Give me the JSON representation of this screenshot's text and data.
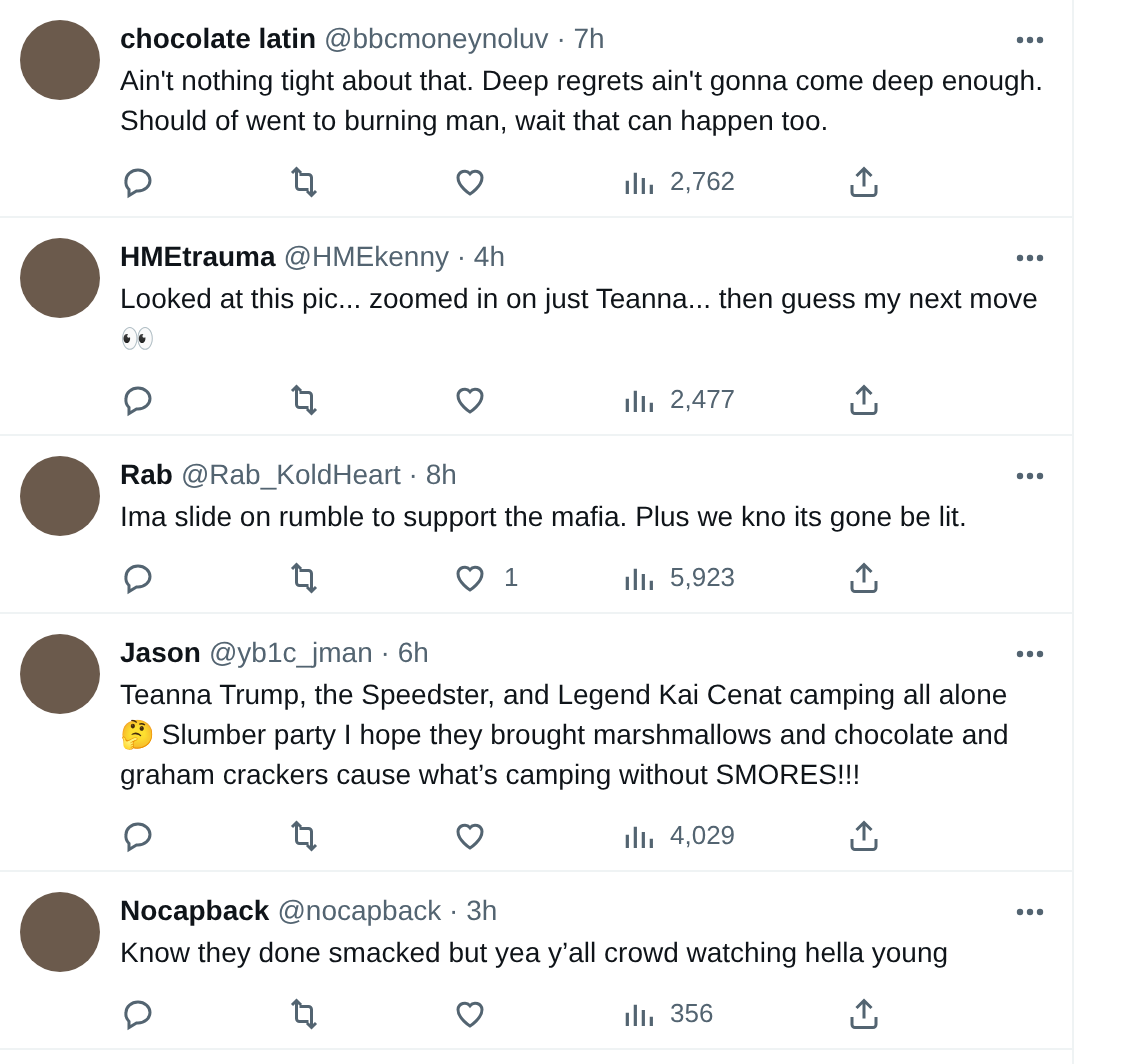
{
  "tweets": [
    {
      "name": "chocolate latin",
      "handle_time": "@bbcmoneynoluv · 7h",
      "text": "Ain't nothing tight about that. Deep regrets ain't gonna come deep enough. Should of went to burning man, wait that can happen too.",
      "views": "2,762"
    },
    {
      "name": "HMEtrauma",
      "handle_time": "@HMEkenny · 4h",
      "text": "Looked at this pic... zoomed in on just Teanna... then guess my next move 👀",
      "views": "2,477"
    },
    {
      "name": "Rab",
      "handle_time": "@Rab_KoldHeart · 8h",
      "text": "Ima slide on rumble to support the mafia. Plus we kno its gone be lit.",
      "likes": "1",
      "views": "5,923"
    },
    {
      "name": "Jason",
      "handle_time": "@yb1c_jman · 6h",
      "text": "Teanna Trump, the Speedster, and Legend Kai Cenat camping all alone 🤔 Slumber party I hope they brought marshmallows and chocolate and graham crackers cause what’s camping without SMORES!!!",
      "views": "4,029"
    },
    {
      "name": "Nocapback",
      "handle_time": "@nocapback · 3h",
      "text": "Know they done smacked but yea y’all crowd watching hella young",
      "views": "356"
    }
  ]
}
